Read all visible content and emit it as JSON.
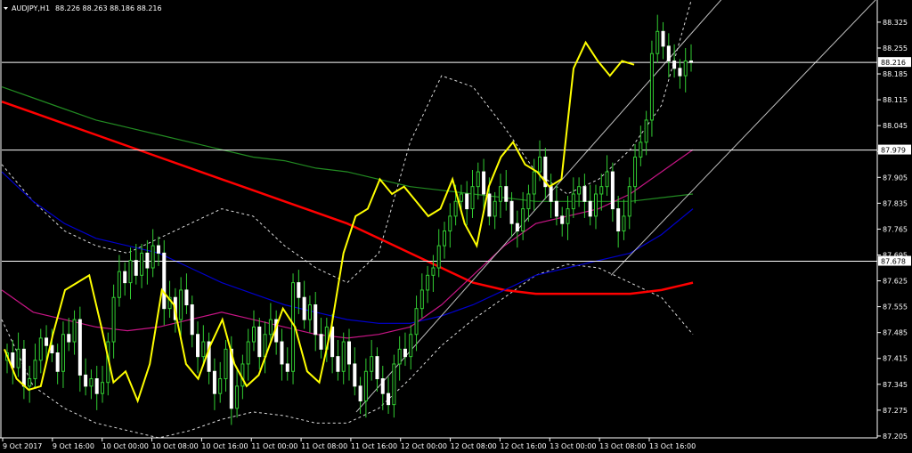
{
  "header": {
    "symbol": "AUDJPY,H1",
    "ohlc": "88.226 88.263 88.186 88.216"
  },
  "colors": {
    "background": "#000000",
    "candle_up": "#32cd32",
    "candle_down": "#ffffff",
    "yellow_line": "#ffff00",
    "red_ma": "#ff0000",
    "green_ma": "#228b22",
    "blue_ma": "#0000cd",
    "magenta_ma": "#c71585",
    "bands": "#ffffff",
    "hlines": "#ffffff",
    "channel": "#c0c0c0"
  },
  "chart_data": {
    "type": "line",
    "title": "AUDJPY,H1",
    "ylim": [
      87.2,
      88.385
    ],
    "y_ticks": [
      "88.325",
      "88.255",
      "88.185",
      "88.115",
      "88.045",
      "87.975",
      "87.905",
      "87.835",
      "87.765",
      "87.695",
      "87.625",
      "87.555",
      "87.485",
      "87.415",
      "87.345",
      "87.275",
      "87.205"
    ],
    "x_ticks": [
      "9 Oct 2017",
      "9 Oct 16:00",
      "10 Oct 00:00",
      "10 Oct 08:00",
      "10 Oct 16:00",
      "11 Oct 00:00",
      "11 Oct 08:00",
      "11 Oct 16:00",
      "12 Oct 00:00",
      "12 Oct 08:00",
      "12 Oct 16:00",
      "13 Oct 00:00",
      "13 Oct 08:00",
      "13 Oct 16:00"
    ],
    "price_labels": [
      {
        "label": "88.216",
        "value": 88.216
      },
      {
        "label": "87.979",
        "value": 87.979
      },
      {
        "label": "87.678",
        "value": 87.678
      }
    ],
    "close_values": [
      87.43,
      87.39,
      87.44,
      87.34,
      87.36,
      87.41,
      87.47,
      87.45,
      87.43,
      87.38,
      87.48,
      87.46,
      87.52,
      87.37,
      87.34,
      87.36,
      87.32,
      87.35,
      87.46,
      87.58,
      87.65,
      87.62,
      87.68,
      87.64,
      87.7,
      87.66,
      87.72,
      87.7,
      87.55,
      87.58,
      87.52,
      87.6,
      87.56,
      87.48,
      87.42,
      87.46,
      87.38,
      87.32,
      87.36,
      87.44,
      87.28,
      87.34,
      87.4,
      87.46,
      87.5,
      87.42,
      87.48,
      87.52,
      87.46,
      87.4,
      87.38,
      87.62,
      87.58,
      87.52,
      87.56,
      87.48,
      87.44,
      87.5,
      87.42,
      87.38,
      87.46,
      87.4,
      87.34,
      87.3,
      87.38,
      87.42,
      87.36,
      87.32,
      87.29,
      87.4,
      87.44,
      87.42,
      87.48,
      87.55,
      87.6,
      87.64,
      87.66,
      87.72,
      87.76,
      87.8,
      87.84,
      87.86,
      87.82,
      87.88,
      87.92,
      87.86,
      87.8,
      87.84,
      87.88,
      87.84,
      87.78,
      87.76,
      87.82,
      87.86,
      87.92,
      87.96,
      87.88,
      87.84,
      87.8,
      87.78,
      87.82,
      87.86,
      87.88,
      87.84,
      87.8,
      87.86,
      87.88,
      87.92,
      87.82,
      87.76,
      87.8,
      87.88,
      87.96,
      88.0,
      88.06,
      88.24,
      88.3,
      88.26,
      88.22,
      88.2,
      88.18,
      88.22,
      88.216
    ],
    "yellow_values": [
      87.44,
      87.36,
      87.33,
      87.34,
      87.48,
      87.6,
      87.62,
      87.64,
      87.5,
      87.35,
      87.38,
      87.3,
      87.4,
      87.6,
      87.56,
      87.4,
      87.36,
      87.45,
      87.52,
      87.4,
      87.34,
      87.37,
      87.46,
      87.55,
      87.5,
      87.38,
      87.35,
      87.5,
      87.7,
      87.8,
      87.82,
      87.9,
      87.86,
      87.88,
      87.84,
      87.8,
      87.82,
      87.9,
      87.78,
      87.72,
      87.88,
      87.96,
      88.0,
      87.94,
      87.92,
      87.88,
      87.9,
      88.2,
      88.27,
      88.22,
      88.18,
      88.22,
      88.21
    ],
    "series": [
      {
        "name": "",
        "values": [
          88.11,
          88.08,
          88.05,
          88.02,
          87.99,
          87.96,
          87.93,
          87.9,
          87.87,
          87.84,
          87.81,
          87.78,
          87.74,
          87.7,
          87.66,
          87.62,
          87.6,
          87.59,
          87.59,
          87.59,
          87.59,
          87.6,
          87.62
        ]
      },
      {
        "name": "",
        "values": [
          88.15,
          88.12,
          88.09,
          88.06,
          88.04,
          88.02,
          88.0,
          87.98,
          87.96,
          87.95,
          87.93,
          87.92,
          87.9,
          87.88,
          87.87,
          87.86,
          87.85,
          87.84,
          87.84,
          87.84,
          87.84,
          87.85,
          87.86
        ]
      },
      {
        "name": "",
        "values": [
          87.92,
          87.84,
          87.78,
          87.74,
          87.72,
          87.7,
          87.66,
          87.62,
          87.59,
          87.56,
          87.54,
          87.52,
          87.51,
          87.51,
          87.53,
          87.56,
          87.6,
          87.64,
          87.66,
          87.68,
          87.7,
          87.75,
          87.82
        ]
      },
      {
        "name": "",
        "values": [
          87.6,
          87.54,
          87.52,
          87.5,
          87.49,
          87.5,
          87.52,
          87.54,
          87.52,
          87.5,
          87.48,
          87.47,
          87.48,
          87.5,
          87.56,
          87.64,
          87.72,
          87.78,
          87.8,
          87.82,
          87.86,
          87.92,
          87.98
        ]
      }
    ],
    "bands": {
      "upper": [
        87.94,
        87.84,
        87.76,
        87.72,
        87.7,
        87.74,
        87.78,
        87.82,
        87.8,
        87.72,
        87.66,
        87.62,
        87.7,
        88.0,
        88.18,
        88.15,
        88.04,
        87.92,
        87.86,
        87.9,
        87.98,
        88.1,
        88.4
      ],
      "lower": [
        87.52,
        87.34,
        87.28,
        87.24,
        87.22,
        87.2,
        87.22,
        87.25,
        87.27,
        87.26,
        87.24,
        87.24,
        87.28,
        87.36,
        87.45,
        87.52,
        87.58,
        87.64,
        87.67,
        87.66,
        87.62,
        87.58,
        87.48
      ]
    },
    "hlines": [
      88.216,
      87.979,
      87.678
    ],
    "grid": false
  }
}
